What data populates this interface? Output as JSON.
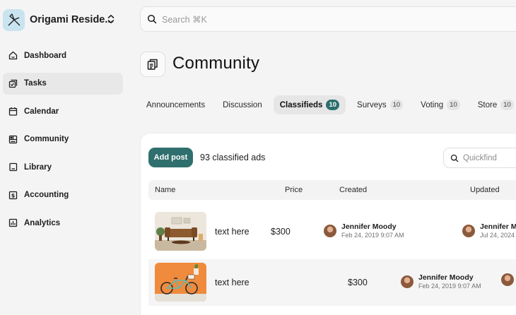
{
  "org": {
    "name": "Origami Reside..."
  },
  "nav": [
    {
      "label": "Dashboard",
      "icon": "home-icon"
    },
    {
      "label": "Tasks",
      "icon": "tasks-icon",
      "active": true
    },
    {
      "label": "Calendar",
      "icon": "calendar-icon"
    },
    {
      "label": "Community",
      "icon": "community-icon"
    },
    {
      "label": "Library",
      "icon": "book-icon"
    },
    {
      "label": "Accounting",
      "icon": "dollar-icon"
    },
    {
      "label": "Analytics",
      "icon": "chart-icon"
    }
  ],
  "search": {
    "placeholder": "Search ⌘K"
  },
  "page": {
    "title": "Community"
  },
  "tabs": [
    {
      "label": "Announcements",
      "count": ""
    },
    {
      "label": "Discussion",
      "count": ""
    },
    {
      "label": "Classifieds",
      "count": "10",
      "active": true
    },
    {
      "label": "Surveys",
      "count": "10"
    },
    {
      "label": "Voting",
      "count": "10"
    },
    {
      "label": "Store",
      "count": "10"
    }
  ],
  "toolbar": {
    "add_label": "Add post",
    "count_text": "93 classified ads",
    "quickfind_placeholder": "Quickfind"
  },
  "table": {
    "headers": {
      "name": "Name",
      "price": "Price",
      "created": "Created",
      "updated": "Updated"
    },
    "rows": [
      {
        "name": "text here",
        "price": "$300",
        "created_by": "Jennifer Moody",
        "created_at": "Feb 24, 2019 9:07 AM",
        "updated_by": "Jennifer M",
        "updated_at": "Jul 24, 2024"
      },
      {
        "name": "text here",
        "price": "$300",
        "created_by": "Jennifer Moody",
        "created_at": "Feb 24, 2019 9:07 AM"
      }
    ]
  },
  "colors": {
    "accent": "#2f6f6d",
    "logo_bg": "#c9e3ef"
  }
}
